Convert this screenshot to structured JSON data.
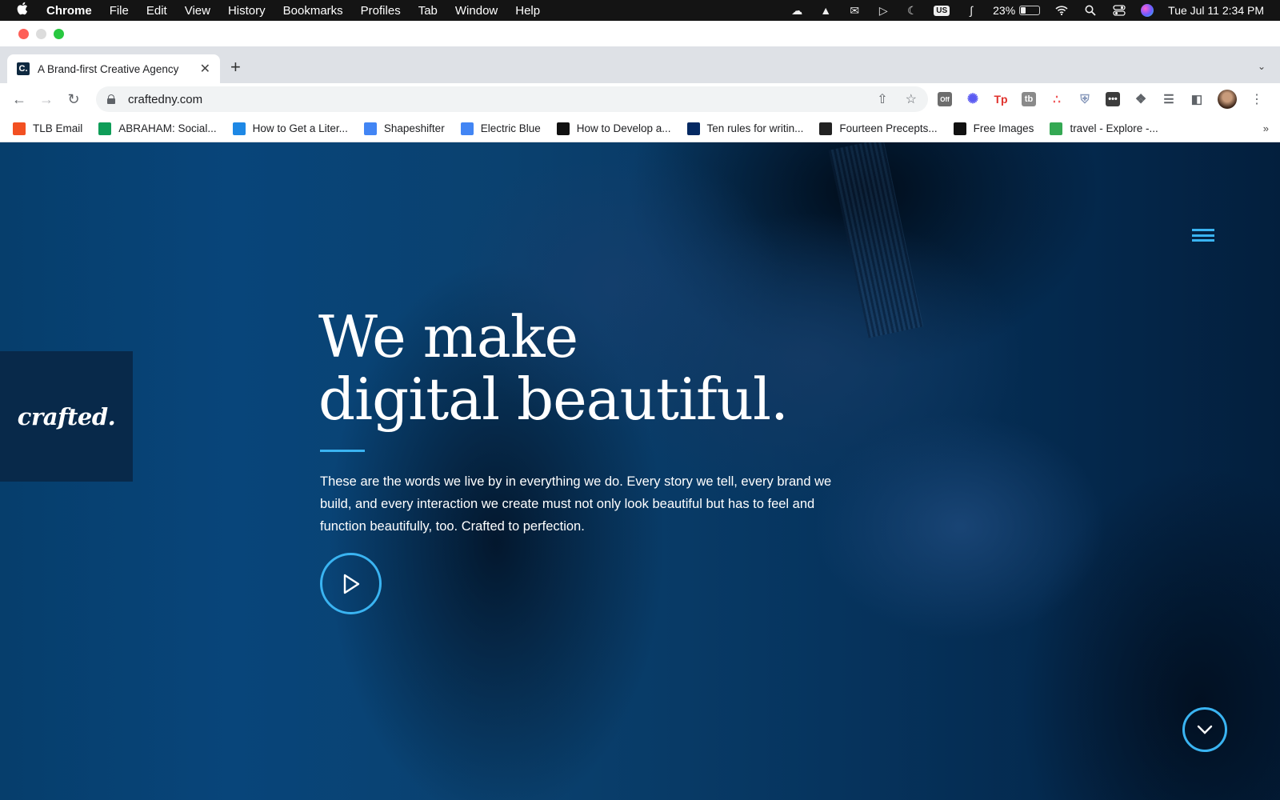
{
  "menubar": {
    "app_name": "Chrome",
    "items": [
      "File",
      "Edit",
      "View",
      "History",
      "Bookmarks",
      "Profiles",
      "Tab",
      "Window",
      "Help"
    ],
    "us_badge": "US",
    "battery_percent": "23%",
    "battery_level": 0.23,
    "datetime": "Tue Jul 11  2:34 PM"
  },
  "browser": {
    "tab_title": "A Brand-first Creative Agency",
    "favicon_letter": "C.",
    "url": "craftedny.com",
    "extensions": {
      "ext_off_badge": "Off",
      "tp_label": "Tp",
      "tb_label": "tb"
    }
  },
  "bookmarks": [
    {
      "label": "TLB Email",
      "icon": "microsoft-icon",
      "color": "#f25022"
    },
    {
      "label": "ABRAHAM: Social...",
      "icon": "sheets-icon",
      "color": "#0f9d58"
    },
    {
      "label": "How to Get a Liter...",
      "icon": "feather-icon",
      "color": "#1e88e5"
    },
    {
      "label": "Shapeshifter",
      "icon": "docs-icon",
      "color": "#4285f4"
    },
    {
      "label": "Electric Blue",
      "icon": "docs-icon",
      "color": "#4285f4"
    },
    {
      "label": "How to Develop a...",
      "icon": "masterclass-icon",
      "color": "#111111"
    },
    {
      "label": "Ten rules for writin...",
      "icon": "guardian-icon",
      "color": "#052962"
    },
    {
      "label": "Fourteen Precepts...",
      "icon": "p-icon",
      "color": "#222222"
    },
    {
      "label": "Free Images",
      "icon": "unsplash-icon",
      "color": "#111111"
    },
    {
      "label": "travel - Explore -...",
      "icon": "trend-icon",
      "color": "#34a853"
    }
  ],
  "hero": {
    "logo": "crafted.",
    "headline_line1": "We make",
    "headline_line2": "digital beautiful.",
    "body": "These are the words we live by in everything we do. Every story we tell, every brand we build, and every interaction we create must not only look beautiful but has to feel and function beautifully, too. Crafted to perfection."
  },
  "colors": {
    "accent": "#3ab4f2",
    "hero_bg": "#06345e",
    "logo_box": "#08294a"
  }
}
